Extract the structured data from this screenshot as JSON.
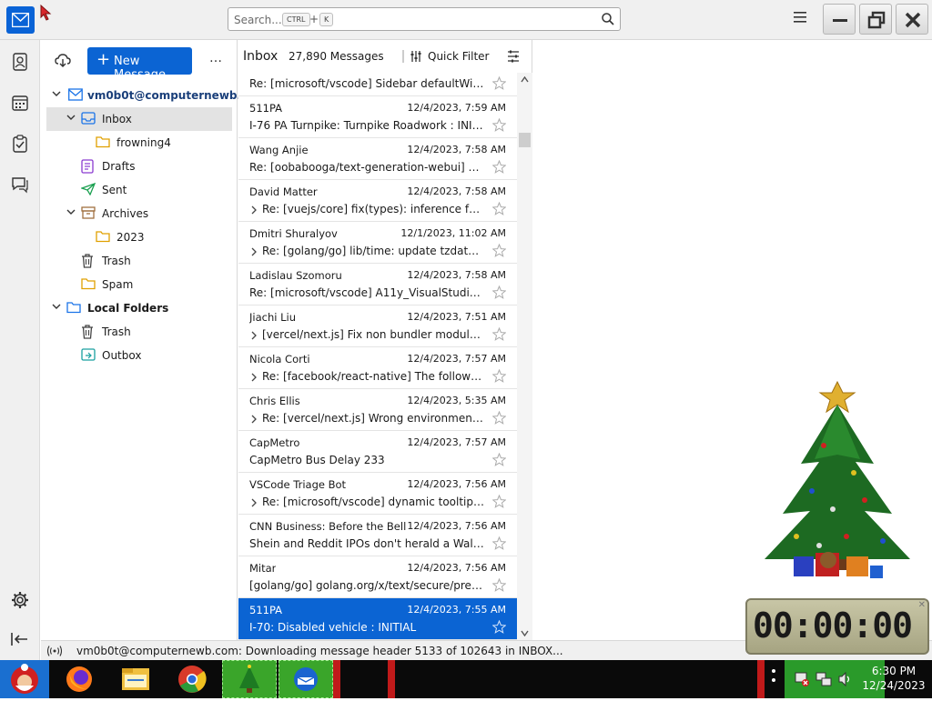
{
  "titlebar": {
    "search_placeholder": "Search...",
    "kbd_ctrl": "CTRL",
    "kbd_plus": "+",
    "kbd_k": "K"
  },
  "folder_pane": {
    "new_message": "New Message",
    "more": "…",
    "account": "vm0b0t@computernewb...",
    "folders": [
      {
        "name": "Inbox"
      },
      {
        "name": "frowning4"
      },
      {
        "name": "Drafts"
      },
      {
        "name": "Sent"
      },
      {
        "name": "Archives"
      },
      {
        "name": "2023"
      },
      {
        "name": "Trash"
      },
      {
        "name": "Spam"
      }
    ],
    "local_folders": "Local Folders",
    "local_items": [
      {
        "name": "Trash"
      },
      {
        "name": "Outbox"
      }
    ]
  },
  "thread_pane": {
    "title": "Inbox",
    "count": "27,890 Messages",
    "quick_filter": "Quick Filter",
    "messages": [
      {
        "from": "",
        "date": "",
        "subject": "Re: [microsoft/vscode] Sidebar defaultWid..."
      },
      {
        "from": "511PA",
        "date": "12/4/2023, 7:59 AM",
        "subject": "I-76 PA Turnpike: Turnpike Roadwork : INITI..."
      },
      {
        "from": "Wang Anjie",
        "date": "12/4/2023, 7:58 AM",
        "subject": "Re: [oobabooga/text-generation-webui] A..."
      },
      {
        "from": "David Matter",
        "date": "12/4/2023, 7:58 AM",
        "subject": "Re: [vuejs/core] fix(types): inference for ..."
      },
      {
        "from": "Dmitri Shuralyov",
        "date": "12/1/2023, 11:02 AM",
        "subject": "Re: [golang/go] lib/time: update tzdata ..."
      },
      {
        "from": "Ladislau Szomoru",
        "date": "12/4/2023, 7:58 AM",
        "subject": "Re: [microsoft/vscode] A11y_VisualStudioC..."
      },
      {
        "from": "Jiachi Liu",
        "date": "12/4/2023, 7:51 AM",
        "subject": "[vercel/next.js] Fix non bundler module r..."
      },
      {
        "from": "Nicola Corti",
        "date": "12/4/2023, 7:57 AM",
        "subject": "Re: [facebook/react-native] The followin..."
      },
      {
        "from": "Chris Ellis",
        "date": "12/4/2023, 5:35 AM",
        "subject": "Re: [vercel/next.js] Wrong environment v..."
      },
      {
        "from": "CapMetro",
        "date": "12/4/2023, 7:57 AM",
        "subject": "CapMetro Bus Delay 233"
      },
      {
        "from": "VSCode Triage Bot",
        "date": "12/4/2023, 7:56 AM",
        "subject": "Re: [microsoft/vscode] dynamic tooltip (..."
      },
      {
        "from": "CNN Business: Before the Bell",
        "date": "12/4/2023, 7:56 AM",
        "subject": "Shein and Reddit IPOs don't herald a Wall ..."
      },
      {
        "from": "Mitar",
        "date": "12/4/2023, 7:56 AM",
        "subject": "[golang/go] golang.org/x/text/secure/prec..."
      },
      {
        "from": "511PA",
        "date": "12/4/2023, 7:55 AM",
        "subject": "I-70: Disabled vehicle : INITIAL"
      }
    ]
  },
  "status_bar": {
    "text": "vm0b0t@computernewb.com: Downloading message header 5133 of 102643 in INBOX..."
  },
  "desktop": {
    "timer": "00:00:00"
  },
  "taskbar": {
    "time": "6:30 PM",
    "date": "12/24/2023"
  },
  "colors": {
    "accent": "#0b64d3",
    "selected_row": "#e3e3e3"
  }
}
